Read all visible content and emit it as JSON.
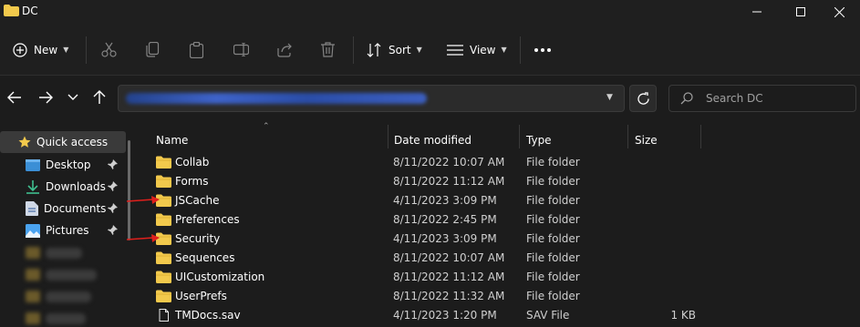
{
  "window": {
    "title": "DC"
  },
  "toolbar": {
    "new_label": "New",
    "sort_label": "Sort",
    "view_label": "View",
    "more_label": "···"
  },
  "search": {
    "placeholder": "Search DC"
  },
  "nav": {
    "quick_access": "Quick access",
    "items": [
      {
        "label": "Desktop",
        "icon": "desktop-icon"
      },
      {
        "label": "Downloads",
        "icon": "download-icon"
      },
      {
        "label": "Documents",
        "icon": "document-icon"
      },
      {
        "label": "Pictures",
        "icon": "picture-icon"
      }
    ]
  },
  "columns": {
    "name": "Name",
    "date": "Date modified",
    "type": "Type",
    "size": "Size"
  },
  "files": [
    {
      "name": "Collab",
      "date": "8/11/2022 10:07 AM",
      "type": "File folder",
      "size": "",
      "kind": "folder",
      "marked": false
    },
    {
      "name": "Forms",
      "date": "8/11/2022 11:12 AM",
      "type": "File folder",
      "size": "",
      "kind": "folder",
      "marked": false
    },
    {
      "name": "JSCache",
      "date": "4/11/2023 3:09 PM",
      "type": "File folder",
      "size": "",
      "kind": "folder",
      "marked": true
    },
    {
      "name": "Preferences",
      "date": "8/11/2022 2:45 PM",
      "type": "File folder",
      "size": "",
      "kind": "folder",
      "marked": false
    },
    {
      "name": "Security",
      "date": "4/11/2023 3:09 PM",
      "type": "File folder",
      "size": "",
      "kind": "folder",
      "marked": true
    },
    {
      "name": "Sequences",
      "date": "8/11/2022 10:07 AM",
      "type": "File folder",
      "size": "",
      "kind": "folder",
      "marked": false
    },
    {
      "name": "UICustomization",
      "date": "8/11/2022 11:12 AM",
      "type": "File folder",
      "size": "",
      "kind": "folder",
      "marked": false
    },
    {
      "name": "UserPrefs",
      "date": "8/11/2022 11:32 AM",
      "type": "File folder",
      "size": "",
      "kind": "folder",
      "marked": false
    },
    {
      "name": "TMDocs.sav",
      "date": "4/11/2023 1:20 PM",
      "type": "SAV File",
      "size": "1 KB",
      "kind": "file",
      "marked": false
    }
  ],
  "colors": {
    "folder": "#f2c94c",
    "annotation_arrow": "#e0201c",
    "accent": "#4aa3f0"
  }
}
